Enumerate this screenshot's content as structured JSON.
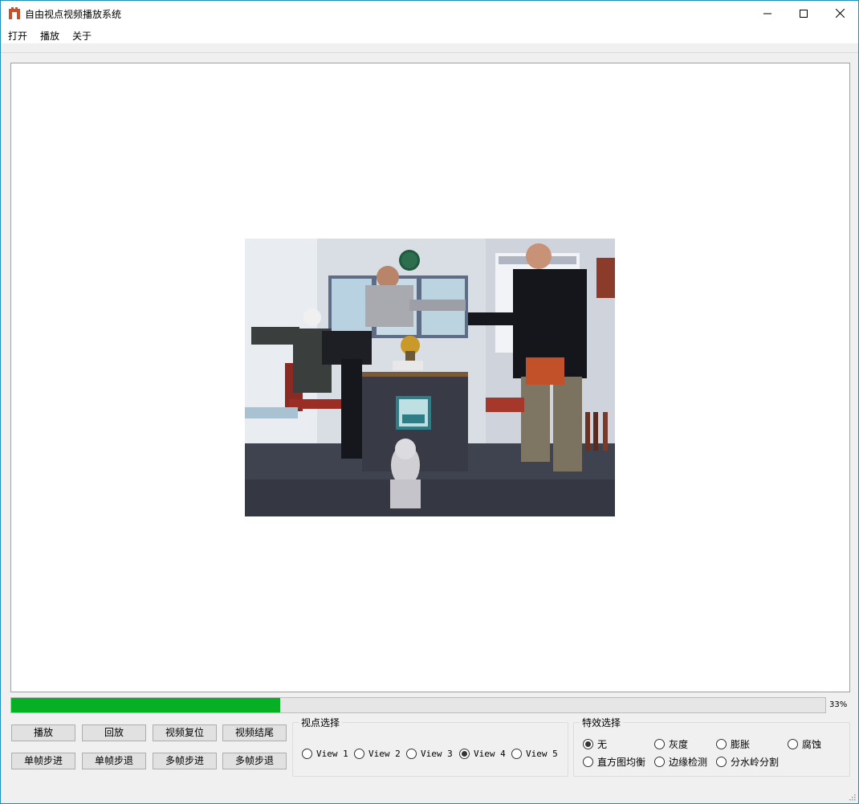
{
  "window": {
    "title": "自由视点视频播放系统"
  },
  "menu": {
    "items": [
      "打开",
      "播放",
      "关于"
    ]
  },
  "progress": {
    "value": 0.33,
    "label": "33%"
  },
  "controls": {
    "buttons_row1": [
      "播放",
      "回放",
      "视频复位",
      "视频结尾"
    ],
    "buttons_row2": [
      "单帧步进",
      "单帧步退",
      "多帧步进",
      "多帧步退"
    ]
  },
  "view_select": {
    "title": "视点选择",
    "options": [
      "View 1",
      "View 2",
      "View 3",
      "View 4",
      "View 5"
    ],
    "selected_index": 3
  },
  "effect_select": {
    "title": "特效选择",
    "options": [
      "无",
      "灰度",
      "膨胀",
      "腐蚀",
      "直方图均衡",
      "边缘检测",
      "分水岭分割"
    ],
    "selected_index": 0
  },
  "colors": {
    "progress_fill": "#06b025",
    "window_border": "#1e8fbf",
    "app_icon": "#c8502a"
  },
  "icons": [
    "app-icon",
    "minimize-icon",
    "maximize-icon",
    "close-icon",
    "resize-grip-icon"
  ]
}
